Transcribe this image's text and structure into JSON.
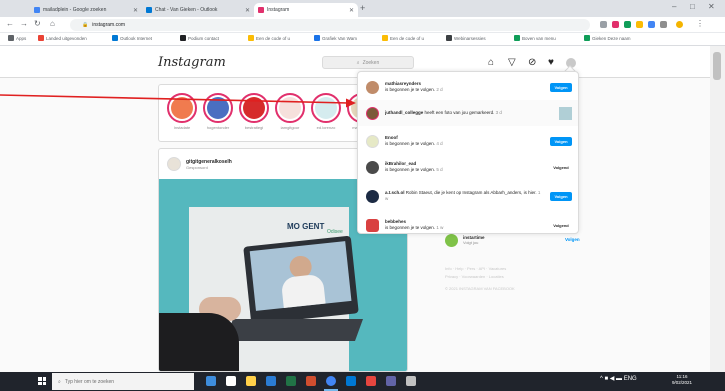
{
  "browser": {
    "tabs": [
      {
        "title": "mailadplein - Google zoeken",
        "color": "#4285f4"
      },
      {
        "title": "Chat - Van Gieken - Outlook",
        "color": "#0078d4"
      },
      {
        "title": "Instagram",
        "color": "#e1306c"
      }
    ],
    "url": "instagram.com",
    "bookmarks": [
      {
        "label": "Apps",
        "color": "#5f6368"
      },
      {
        "label": "Landed uitgevonden",
        "color": "#ea4335"
      },
      {
        "label": "Outlook Internet",
        "color": "#0078d4"
      },
      {
        "label": "Podium contact",
        "color": "#202124"
      },
      {
        "label": "Een de code of u",
        "color": "#fbbc05"
      },
      {
        "label": "Grafiek Van Wam",
        "color": "#1a73e8"
      },
      {
        "label": "Een de code of u",
        "color": "#fbbc05"
      },
      {
        "label": "Webinarsessies",
        "color": "#3c4043"
      },
      {
        "label": "Boven van menu",
        "color": "#0f9d58"
      },
      {
        "label": "Gieken Deze naam",
        "color": "#0f9d58"
      }
    ]
  },
  "instagram": {
    "logo": "Instagram",
    "search_placeholder": "Zoeken",
    "stories": [
      {
        "label": "Instadate",
        "color": "#f07b4f"
      },
      {
        "label": "hogentonder",
        "color": "#4a6fc1"
      },
      {
        "label": "bestratiegi",
        "color": "#d62b2b"
      },
      {
        "label": "iamgitgoor",
        "color": "#f6e0dc"
      },
      {
        "label": "ed.lorenzo",
        "color": "#d5ecef"
      },
      {
        "label": "mauricelier",
        "color": "#e6d8bd"
      }
    ],
    "post": {
      "user": "gitgitgeneralkoselh",
      "subtitle": "Gesponsord",
      "logo_brand": "MO GENT",
      "logo_sub": "Odisee"
    },
    "suggestion": {
      "user": "instartime",
      "sub": "Volgt jou",
      "action": "Volgen"
    },
    "footer": [
      "Info · Help · Pers · API · Vacatures",
      "Privacy · Voorwaarden · Locaties",
      "© 2021 INSTAGRAM VAN FACEBOOK"
    ]
  },
  "notifications": [
    {
      "user": "mathiasreynders",
      "text": "is begonnen je te volgen.",
      "time": "2 d",
      "avatar": "#c08c6a",
      "action": "Volgen",
      "action_type": "follow"
    },
    {
      "user": "juthandl_collegge",
      "text": "heeft een foto van jou gemarkeerd.",
      "time": "3 d",
      "avatar": "#7c5a3a",
      "action": "",
      "action_type": "thumb"
    },
    {
      "user": "Enoof",
      "text": "is begonnen je te volgen.",
      "time": "4 d",
      "avatar": "#e6e9c6",
      "action": "Volgen",
      "action_type": "follow"
    },
    {
      "user": "ikBrahilor_ead",
      "text": "is begonnen je te volgen.",
      "time": "5 d",
      "avatar": "#4a4a4a",
      "action": "Volgend",
      "action_type": "following"
    },
    {
      "user": "a.t.sch.ol",
      "text": "Robin Staeut, die je kent op Instagram als Abbarh_anders, is hier.",
      "time": "1 w",
      "avatar": "#1c2b44",
      "action": "Volgen",
      "action_type": "follow"
    },
    {
      "user": "bebbehes",
      "text": "is begonnen je te volgen.",
      "time": "1 w",
      "avatar": "#d94141",
      "action": "Volgend",
      "action_type": "following"
    }
  ],
  "taskbar": {
    "search_placeholder": "Typ hier om te zoeken",
    "apps": [
      "#3e8ddd",
      "#fff",
      "#ffd04a",
      "#2b7cd3",
      "#217346",
      "#d04e2f",
      "#4285f4",
      "#0078d4",
      "#e6463f",
      "#6264a7",
      "#c1c1c1"
    ],
    "tray": "^  ■  ◀  ▬  ENG",
    "time": "11:16",
    "date": "9/02/2021"
  }
}
